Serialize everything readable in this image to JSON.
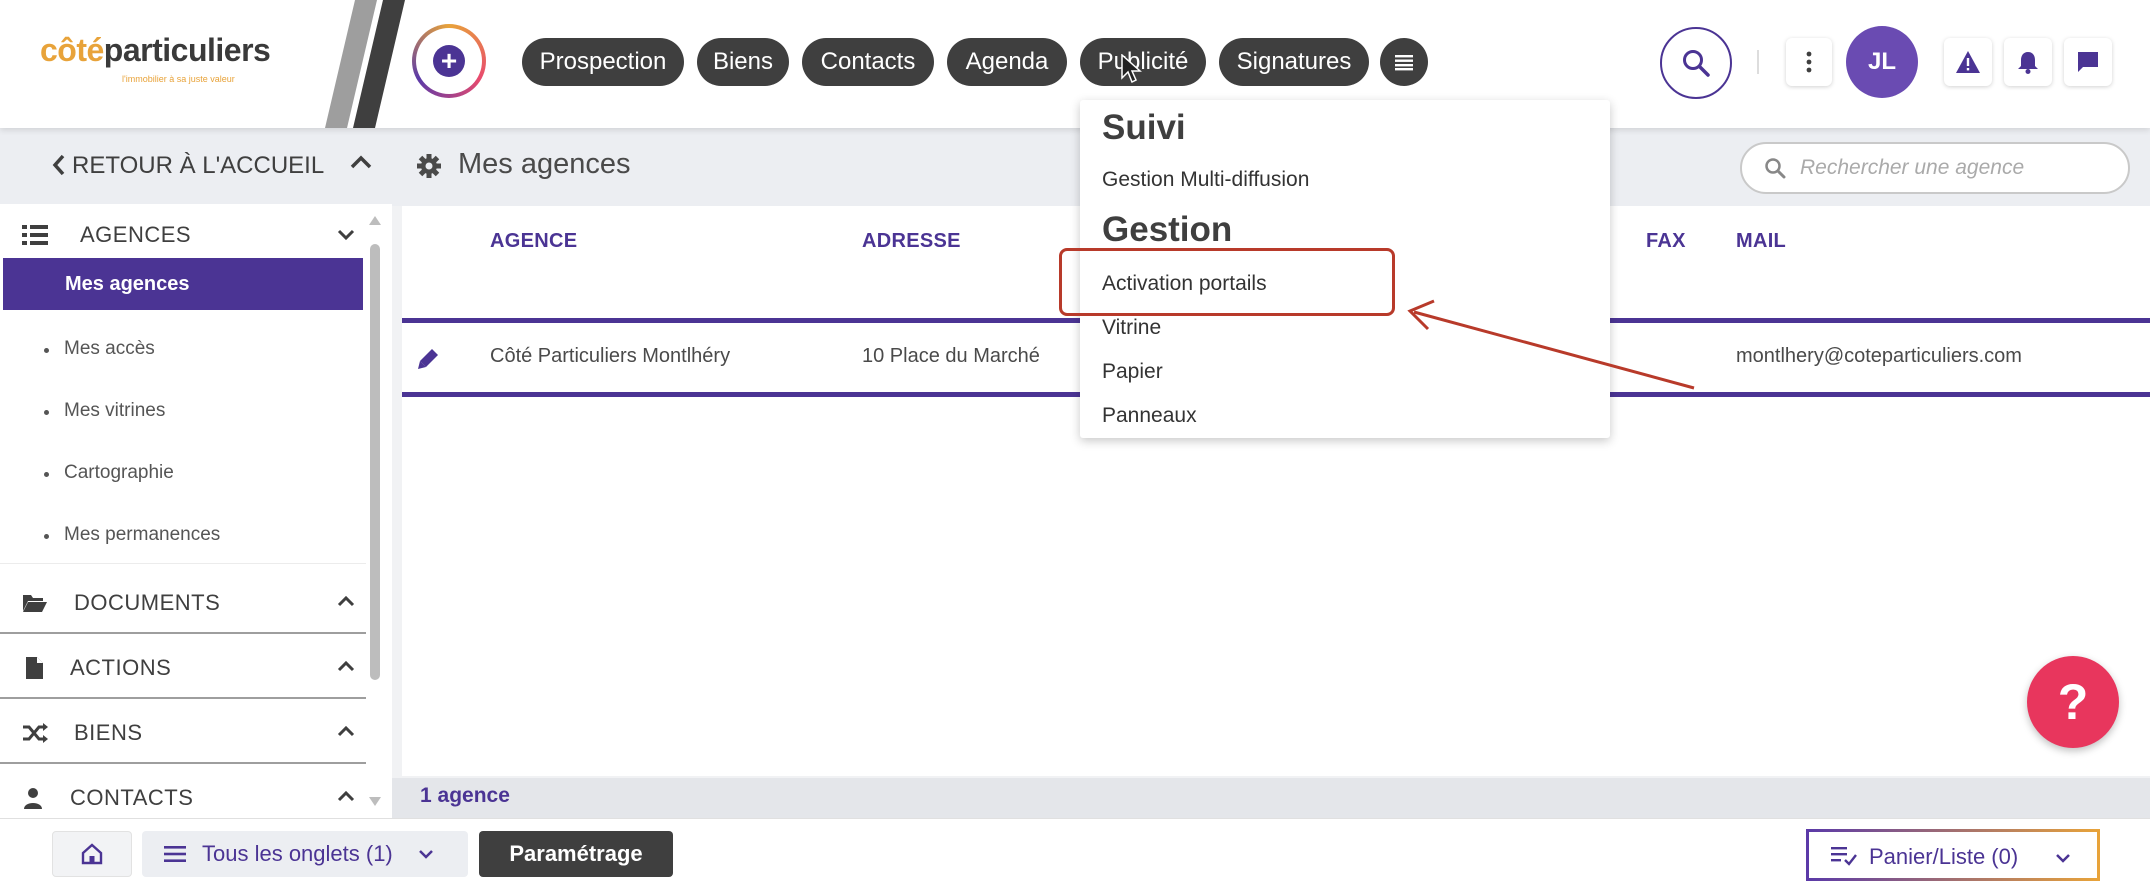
{
  "logo": {
    "brand_first": "côté",
    "brand_second": "particuliers",
    "tagline": "l'immobilier à sa juste valeur"
  },
  "nav": {
    "items": [
      "Prospection",
      "Biens",
      "Contacts",
      "Agenda",
      "Publicité",
      "Signatures"
    ]
  },
  "user": {
    "initials": "JL"
  },
  "sidebar": {
    "back_label": "RETOUR À L'ACCUEIL",
    "agences": {
      "label": "AGENCES",
      "items": [
        "Mes agences",
        "Mes accès",
        "Mes vitrines",
        "Cartographie",
        "Mes permanences"
      ]
    },
    "sections": [
      "DOCUMENTS",
      "ACTIONS",
      "BIENS",
      "CONTACTS"
    ]
  },
  "main": {
    "title": "Mes agences",
    "search_placeholder": "Rechercher une agence",
    "columns": {
      "agence": "AGENCE",
      "adresse": "ADRESSE",
      "fax": "FAX",
      "mail": "MAIL"
    },
    "rows": [
      {
        "agence": "Côté Particuliers Montlhéry",
        "adresse": "10 Place du Marché",
        "fax": "",
        "mail": "montlhery@coteparticuliers.com"
      }
    ],
    "count": "1 agence"
  },
  "dropdown": {
    "suivi": {
      "heading": "Suivi",
      "items": [
        "Gestion Multi-diffusion"
      ]
    },
    "gestion": {
      "heading": "Gestion",
      "items": [
        "Activation portails",
        "Vitrine",
        "Papier",
        "Panneaux"
      ]
    }
  },
  "bottom": {
    "tabs_label": "Tous les onglets (1)",
    "param_label": "Paramétrage",
    "panier_label": "Panier/Liste (0)"
  },
  "help_label": "?",
  "colors": {
    "brand_purple": "#4b3494",
    "brand_orange": "#e8a33a",
    "nav_pill": "#3f3f3f",
    "annotation_red": "#b83a2a",
    "help_pink": "#e8365d"
  }
}
